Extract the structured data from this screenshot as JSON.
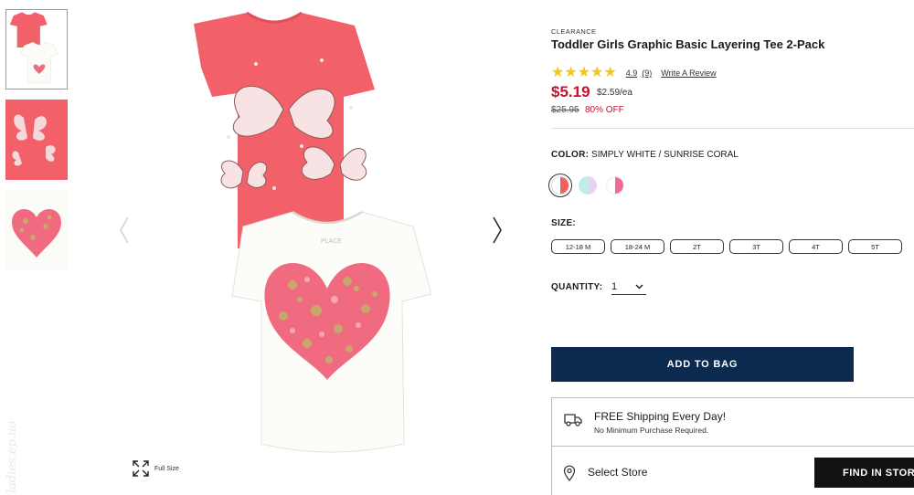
{
  "gallery": {
    "thumbnails": [
      "tees-two-pack",
      "butterfly-print",
      "heart-print"
    ],
    "full_size_label": "Full Size"
  },
  "product": {
    "tag": "CLEARANCE",
    "title": "Toddler Girls Graphic Basic Layering Tee 2-Pack",
    "rating": {
      "stars": 5,
      "value": "4.9",
      "count": "(9)",
      "write_review": "Write A Review"
    },
    "price": "$5.19",
    "unit_price": "$2.59/ea",
    "original_price": "$25.95",
    "discount": "80% OFF"
  },
  "color": {
    "label": "COLOR:",
    "selected": "SIMPLY WHITE / SUNRISE CORAL",
    "swatches": [
      {
        "name": "white-coral",
        "left": "#ffffff",
        "right": "#f0605f"
      },
      {
        "name": "mint-lilac",
        "left": "#bfeee8",
        "right": "#e7d3f2"
      },
      {
        "name": "white-pink",
        "left": "#ffffff",
        "right": "#f06a9a"
      }
    ]
  },
  "size": {
    "label": "SIZE:",
    "options": [
      "12-18 M",
      "18-24 M",
      "2T",
      "3T",
      "4T",
      "5T"
    ]
  },
  "quantity": {
    "label": "QUANTITY:",
    "value": "1"
  },
  "actions": {
    "add_to_bag": "ADD TO BAG",
    "find_in_store": "FIND IN STORE"
  },
  "shipping": {
    "title": "FREE Shipping Every Day!",
    "subtitle": "No Minimum Purchase Required.",
    "select_store": "Select Store"
  },
  "watermark": "ladies.ep.uo",
  "colors": {
    "accent_red": "#c8102e",
    "navy": "#0b2a4e",
    "star": "#f5c518",
    "coral": "#f0605f"
  }
}
